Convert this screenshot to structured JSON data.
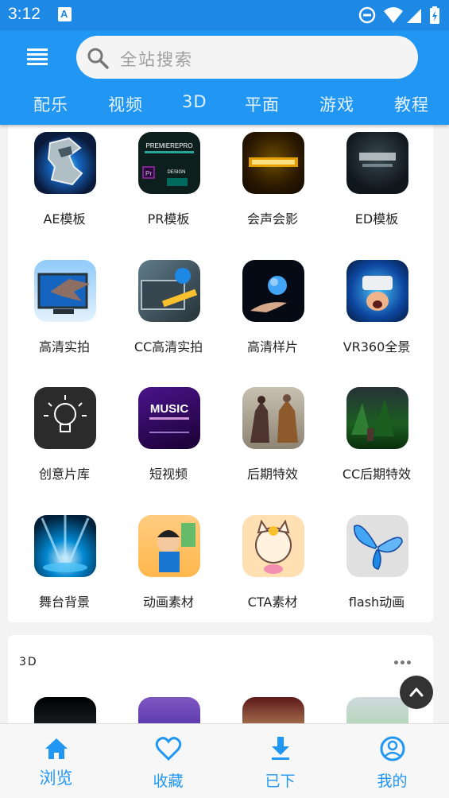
{
  "status_bar": {
    "time": "3:12"
  },
  "header": {
    "search_placeholder": "全站搜索",
    "tabs": [
      "配乐",
      "视频",
      "3D",
      "平面",
      "游戏",
      "教程"
    ]
  },
  "categories": [
    {
      "label": "AE模板",
      "icon": "ae-template-thumb"
    },
    {
      "label": "PR模板",
      "icon": "pr-template-thumb"
    },
    {
      "label": "会声会影",
      "icon": "corel-videostudio-thumb"
    },
    {
      "label": "ED模板",
      "icon": "ed-template-thumb"
    },
    {
      "label": "高清实拍",
      "icon": "hd-footage-thumb"
    },
    {
      "label": "CC高清实拍",
      "icon": "cc-hd-footage-thumb"
    },
    {
      "label": "高清样片",
      "icon": "hd-sample-thumb"
    },
    {
      "label": "VR360全景",
      "icon": "vr360-thumb"
    },
    {
      "label": "创意片库",
      "icon": "creative-library-thumb"
    },
    {
      "label": "短视频",
      "icon": "short-video-thumb"
    },
    {
      "label": "后期特效",
      "icon": "post-effects-thumb"
    },
    {
      "label": "CC后期特效",
      "icon": "cc-post-effects-thumb"
    },
    {
      "label": "舞台背景",
      "icon": "stage-background-thumb"
    },
    {
      "label": "动画素材",
      "icon": "animation-material-thumb"
    },
    {
      "label": "CTA素材",
      "icon": "cta-material-thumb"
    },
    {
      "label": "flash动画",
      "icon": "flash-animation-thumb"
    }
  ],
  "section_3d": {
    "title": "3D"
  },
  "bottom_nav": [
    {
      "label": "浏览",
      "icon": "home-icon"
    },
    {
      "label": "收藏",
      "icon": "heart-icon"
    },
    {
      "label": "已下",
      "icon": "download-icon"
    },
    {
      "label": "我的",
      "icon": "account-icon"
    }
  ],
  "colors": {
    "primary": "#2196f3",
    "status_bar": "#1e88e5",
    "background": "#f3f3f3"
  }
}
